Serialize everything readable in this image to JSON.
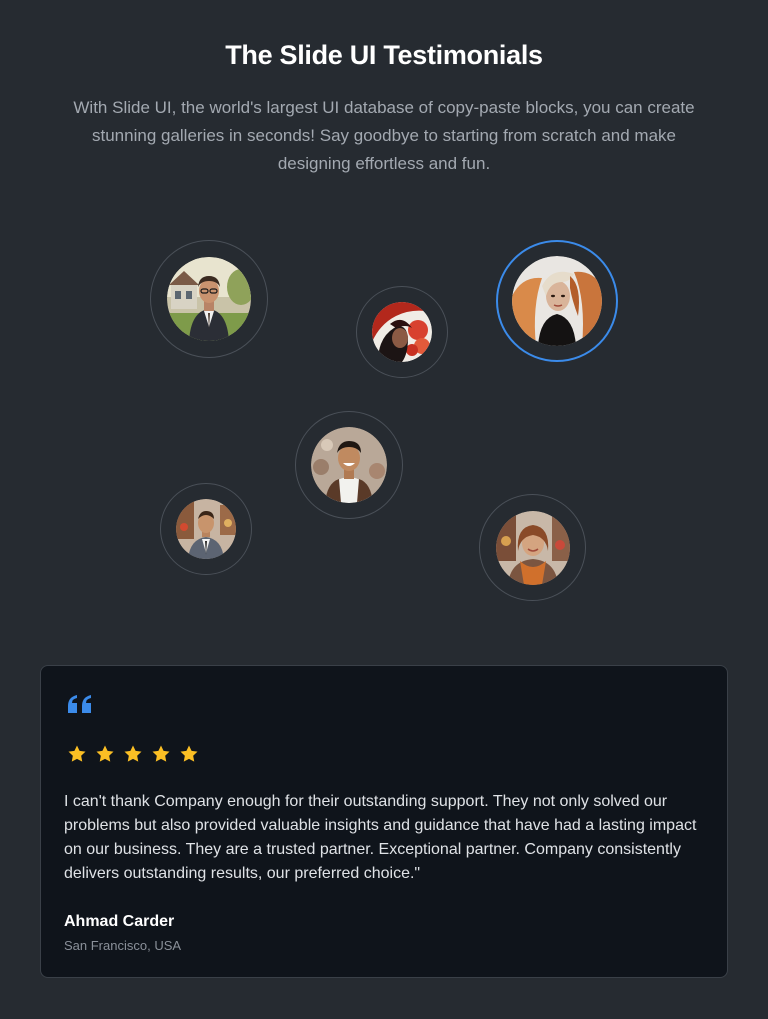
{
  "header": {
    "title": "The Slide UI Testimonials",
    "subtitle": "With Slide UI, the world's largest UI database of copy-paste blocks, you can create stunning galleries in seconds! Say goodbye to starting from scratch and make designing effortless and fun."
  },
  "avatars": [
    {
      "name": "avatar-man-suit-house",
      "selected": false
    },
    {
      "name": "avatar-woman-red-flowers",
      "selected": false
    },
    {
      "name": "avatar-woman-flowing-hair",
      "selected": true
    },
    {
      "name": "avatar-man-smiling",
      "selected": false
    },
    {
      "name": "avatar-man-blazer",
      "selected": false
    },
    {
      "name": "avatar-woman-orange-scarf",
      "selected": false
    }
  ],
  "testimonial": {
    "quote_icon": "quote-icon",
    "rating": 5,
    "rating_max": 5,
    "text": "I can't thank Company enough for their outstanding support. They not only solved our problems but also provided valuable insights and guidance that have had a lasting impact on our business. They are a trusted partner. Exceptional partner. Company consistently delivers outstanding results, our preferred choice.\"",
    "author": "Ahmad Carder",
    "location": "San Francisco, USA"
  },
  "colors": {
    "background": "#262b31",
    "card": "#0f141b",
    "accent": "#3b8bea",
    "star": "#fbbf24"
  }
}
